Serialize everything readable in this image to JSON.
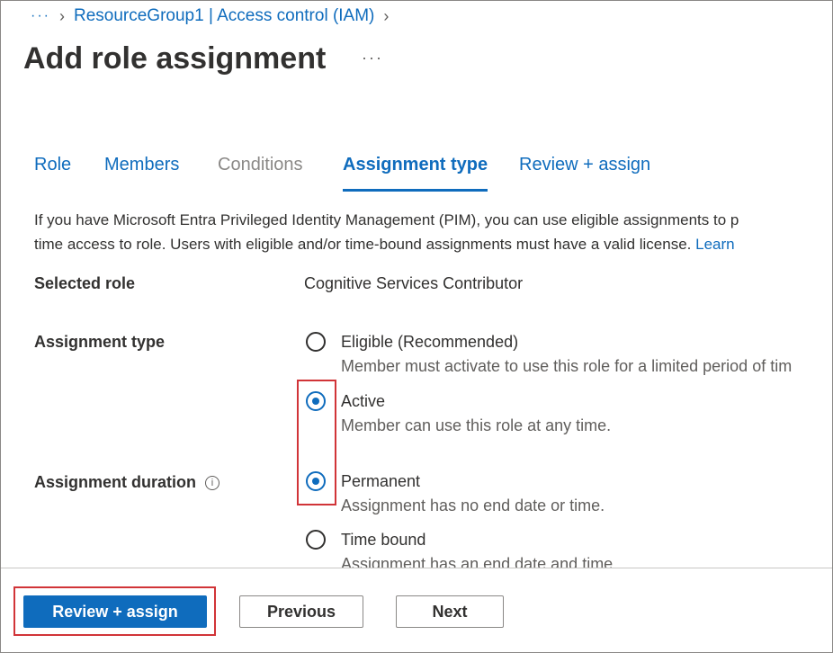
{
  "breadcrumb": {
    "more": "···",
    "item": "ResourceGroup1 | Access control (IAM)"
  },
  "page": {
    "title": "Add role assignment",
    "more": "···"
  },
  "tabs": [
    {
      "label": "Role",
      "state": "enabled"
    },
    {
      "label": "Members",
      "state": "enabled"
    },
    {
      "label": "Conditions",
      "state": "disabled"
    },
    {
      "label": "Assignment type",
      "state": "active"
    },
    {
      "label": "Review + assign",
      "state": "enabled"
    }
  ],
  "info": {
    "line1": "If you have Microsoft Entra Privileged Identity Management (PIM), you can use eligible assignments to p",
    "line2": "time access to role. Users with eligible and/or time-bound assignments must have a valid license. ",
    "link": "Learn"
  },
  "form": {
    "selected_role_label": "Selected role",
    "selected_role_value": "Cognitive Services Contributor",
    "assignment_type_label": "Assignment type",
    "assignment_type_options": [
      {
        "title": "Eligible (Recommended)",
        "desc": "Member must activate to use this role for a limited period of tim",
        "checked": false
      },
      {
        "title": "Active",
        "desc": "Member can use this role at any time.",
        "checked": true
      }
    ],
    "assignment_duration_label": "Assignment duration",
    "assignment_duration_options": [
      {
        "title": "Permanent",
        "desc": "Assignment has no end date or time.",
        "checked": true
      },
      {
        "title": "Time bound",
        "desc": "Assignment has an end date and time.",
        "checked": false
      }
    ]
  },
  "footer": {
    "review_assign": "Review + assign",
    "previous": "Previous",
    "next": "Next"
  },
  "colors": {
    "accent": "#0f6cbd",
    "highlight": "#d13438"
  }
}
